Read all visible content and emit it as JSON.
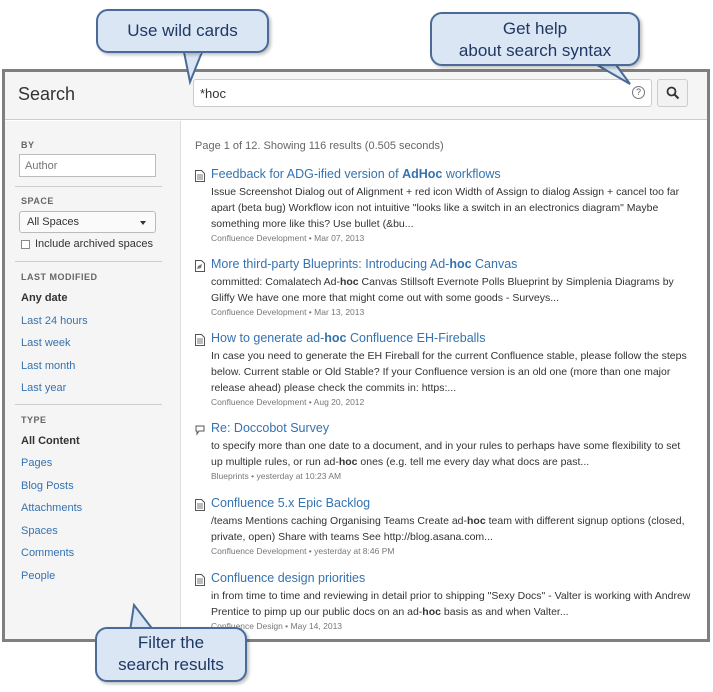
{
  "header": {
    "title": "Search",
    "query": "*hoc"
  },
  "sidebar": {
    "by_label": "BY",
    "author_placeholder": "Author",
    "space_label": "SPACE",
    "space_value": "All Spaces",
    "include_archived": "Include archived spaces",
    "last_modified_label": "LAST MODIFIED",
    "modified_options": [
      "Any date",
      "Last 24 hours",
      "Last week",
      "Last month",
      "Last year"
    ],
    "type_label": "TYPE",
    "type_options": [
      "All Content",
      "Pages",
      "Blog Posts",
      "Attachments",
      "Spaces",
      "Comments",
      "People"
    ]
  },
  "results_summary": "Page 1 of 12. Showing 116 results (0.505 seconds)",
  "results": [
    {
      "icon": "page-icon",
      "title_pre": "Feedback for ADG-ified version of ",
      "title_bold": "AdHoc",
      "title_post": " workflows",
      "snippet": "Issue Screenshot Dialog out of Alignment + red icon Width of Assign to dialog Assign + cancel too far apart (beta bug) Workflow icon not intuitive \"looks like a switch in an electronics diagram\" Maybe something more like this? Use bullet (&bu...",
      "meta": "Confluence Development • Mar 07, 2013"
    },
    {
      "icon": "blog-icon",
      "title_pre": "More third-party Blueprints: Introducing Ad-",
      "title_bold": "hoc",
      "title_post": " Canvas",
      "snippet_pre": "committed: Comalatech Ad-",
      "snippet_bold": "hoc",
      "snippet_post": " Canvas Stillsoft Evernote Polls Blueprint by Simplenia Diagrams by Gliffy We have one more that might come out with some goods - Surveys...",
      "meta": "Confluence Development • Mar 13, 2013"
    },
    {
      "icon": "page-icon",
      "title_pre": "How to generate ad-",
      "title_bold": "hoc",
      "title_post": " Confluence EH-Fireballs",
      "snippet": "In case you need to generate the EH Fireball for the current Confluence stable, please follow the steps below. Current stable or Old Stable? If your Confluence version is an old one (more than one major release ahead) please check the commits in: https:...",
      "meta": "Confluence Development • Aug 20, 2012"
    },
    {
      "icon": "comment-icon",
      "title": "Re: Doccobot Survey",
      "snippet_pre": "to specify more than one date to a document, and in your rules to perhaps have some flexibility to set up multiple rules, or run ad-",
      "snippet_bold": "hoc",
      "snippet_post": " ones (e.g. tell me every day what docs are past...",
      "meta": "Blueprints • yesterday at 10:23 AM"
    },
    {
      "icon": "page-icon",
      "title": "Confluence 5.x Epic Backlog",
      "snippet_pre": "/teams Mentions caching Organising Teams Create ad-",
      "snippet_bold": "hoc",
      "snippet_post": " team with different signup options (closed, private, open) Share with teams See http://blog.asana.com...",
      "meta": "Confluence Development • yesterday at 8:46 PM"
    },
    {
      "icon": "page-icon",
      "title": "Confluence design priorities",
      "snippet_pre": "in from time to time and reviewing in detail prior to shipping \"Sexy Docs\" - Valter is working with Andrew Prentice to pimp up our public docs on an ad-",
      "snippet_bold": "hoc",
      "snippet_post": " basis as and when Valter...",
      "meta": "Confluence Design • May 14, 2013"
    }
  ],
  "callouts": {
    "wildcards": "Use wild cards",
    "help_line1": "Get help",
    "help_line2": "about search syntax",
    "filter_line1": "Filter the",
    "filter_line2": "search results"
  },
  "colors": {
    "link": "#3572b0",
    "callout_fill": "#dbe6f4",
    "callout_border": "#4a6a99"
  }
}
